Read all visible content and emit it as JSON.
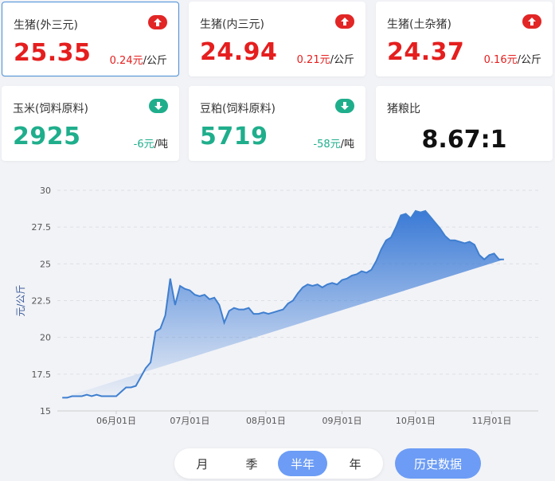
{
  "cards": [
    {
      "label": "生猪(外三元)",
      "value": "25.35",
      "change": "0.24元",
      "unit": "/公斤",
      "trend": "up",
      "badge_icon": "arrow-up-icon"
    },
    {
      "label": "生猪(内三元)",
      "value": "24.94",
      "change": "0.21元",
      "unit": "/公斤",
      "trend": "up",
      "badge_icon": "arrow-up-icon"
    },
    {
      "label": "生猪(土杂猪)",
      "value": "24.37",
      "change": "0.16元",
      "unit": "/公斤",
      "trend": "up",
      "badge_icon": "arrow-up-icon"
    },
    {
      "label": "玉米(饲料原料)",
      "value": "2925",
      "change": "-6元",
      "unit": "/吨",
      "trend": "down",
      "badge_icon": "arrow-down-icon"
    },
    {
      "label": "豆粕(饲料原料)",
      "value": "5719",
      "change": "-58元",
      "unit": "/吨",
      "trend": "down",
      "badge_icon": "arrow-down-icon"
    }
  ],
  "ratio": {
    "label": "猪粮比",
    "value": "8.67:1"
  },
  "colors": {
    "up": "#e51e1e",
    "down": "#1fae8c",
    "accent": "#6c9cf5",
    "line": "#3f7fd0"
  },
  "chart_data": {
    "type": "area",
    "ylabel": "元/公斤",
    "ylim": [
      15,
      30
    ],
    "yticks": [
      "15",
      "17.5",
      "20",
      "22.5",
      "25",
      "27.5",
      "30"
    ],
    "grid": true,
    "xlabels": [
      "06月01日",
      "07月01日",
      "08月01日",
      "09月01日",
      "10月01日",
      "11月01日"
    ],
    "x": [
      -22,
      -20,
      -18,
      -16,
      -14,
      -12,
      -10,
      -8,
      -6,
      -4,
      -2,
      0,
      2,
      4,
      6,
      8,
      10,
      12,
      14,
      16,
      18,
      20,
      22,
      24,
      26,
      28,
      30,
      32,
      34,
      36,
      38,
      40,
      42,
      44,
      46,
      48,
      50,
      52,
      54,
      56,
      58,
      60,
      62,
      64,
      66,
      68,
      70,
      72,
      74,
      76,
      78,
      80,
      82,
      84,
      86,
      88,
      90,
      92,
      94,
      96,
      98,
      100,
      102,
      104,
      106,
      108,
      110,
      112,
      114,
      116,
      118,
      120,
      122,
      124,
      126,
      128,
      130,
      132,
      134,
      136,
      138,
      140,
      142,
      144,
      146,
      148,
      150,
      152,
      154,
      156,
      158,
      160,
      162,
      164,
      166,
      168,
      170
    ],
    "values": [
      15.9,
      15.9,
      16.0,
      16.0,
      16.0,
      16.1,
      16.0,
      16.1,
      16.0,
      16.0,
      16.0,
      16.0,
      16.3,
      16.6,
      16.6,
      16.7,
      17.3,
      17.9,
      18.3,
      20.4,
      20.6,
      21.5,
      24.0,
      22.2,
      23.5,
      23.3,
      23.2,
      22.9,
      22.8,
      22.9,
      22.6,
      22.7,
      22.2,
      21.0,
      21.8,
      22.0,
      21.9,
      21.9,
      22.0,
      21.6,
      21.6,
      21.7,
      21.6,
      21.7,
      21.8,
      21.9,
      22.3,
      22.5,
      23.0,
      23.4,
      23.6,
      23.5,
      23.6,
      23.4,
      23.6,
      23.7,
      23.6,
      23.9,
      24.0,
      24.2,
      24.3,
      24.5,
      24.4,
      24.6,
      25.2,
      26.0,
      26.6,
      26.8,
      27.5,
      28.3,
      28.4,
      28.1,
      28.6,
      28.5,
      28.6,
      28.2,
      27.8,
      27.4,
      26.9,
      26.6,
      26.6,
      26.5,
      26.4,
      26.5,
      26.3,
      25.6,
      25.3,
      25.6,
      25.7,
      25.3,
      25.3
    ],
    "xtick_positions": [
      0,
      30,
      61,
      92,
      122,
      153
    ],
    "xrange": [
      -24,
      172
    ]
  },
  "range_tabs": [
    {
      "label": "月",
      "active": false
    },
    {
      "label": "季",
      "active": false
    },
    {
      "label": "半年",
      "active": true
    },
    {
      "label": "年",
      "active": false
    }
  ],
  "history_button": "历史数据"
}
